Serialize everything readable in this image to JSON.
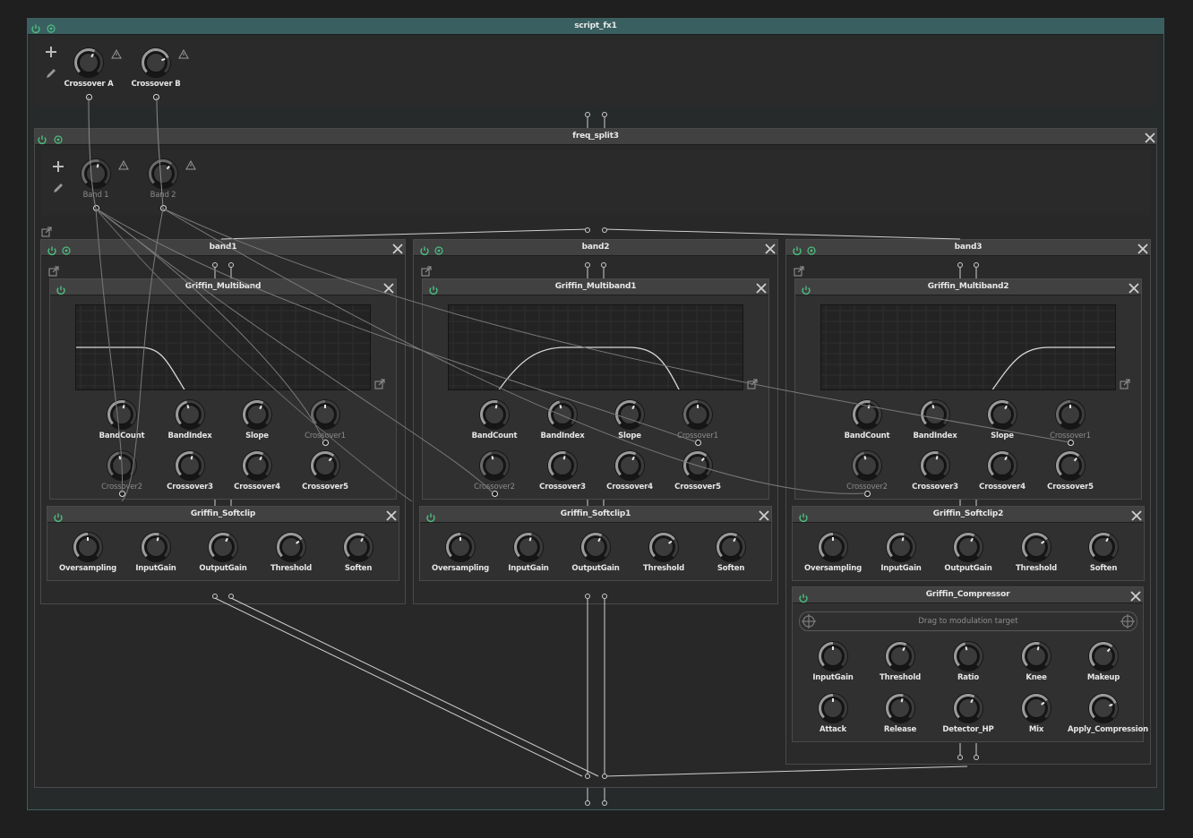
{
  "colors": {
    "accent": "#4cbf80",
    "header_bg": "#414141",
    "panel_bg": "#2b2b2b",
    "root_header": "#3a5f60"
  },
  "script_fx1": {
    "title": "script_fx1",
    "macros": [
      {
        "label": "Crossover A",
        "value": 0.6
      },
      {
        "label": "Crossover B",
        "value": 0.75
      }
    ]
  },
  "freq_split3": {
    "title": "freq_split3",
    "macros": [
      {
        "label": "Band 1",
        "value": 0.55
      },
      {
        "label": "Band 2",
        "value": 0.65
      }
    ]
  },
  "bands": [
    {
      "title": "band1",
      "mb_title": "Griffin_Multiband",
      "sc_title": "Griffin_Softclip",
      "curve": "lowpass"
    },
    {
      "title": "band2",
      "mb_title": "Griffin_Multiband1",
      "sc_title": "Griffin_Softclip1",
      "curve": "bandpass"
    },
    {
      "title": "band3",
      "mb_title": "Griffin_Multiband2",
      "sc_title": "Griffin_Softclip2",
      "curve": "highpass"
    }
  ],
  "multiband_knobs": [
    "BandCount",
    "BandIndex",
    "Slope",
    "Crossover1",
    "Crossover2",
    "Crossover3",
    "Crossover4",
    "Crossover5"
  ],
  "softclip_knobs": [
    "Oversampling",
    "InputGain",
    "OutputGain",
    "Threshold",
    "Soften"
  ],
  "compressor": {
    "title": "Griffin_Compressor",
    "drop_text": "Drag to modulation target",
    "knobs": [
      "InputGain",
      "Threshold",
      "Ratio",
      "Knee",
      "Makeup",
      "Attack",
      "Release",
      "Detector_HP",
      "Mix",
      "Apply_Compression"
    ]
  },
  "icons": [
    "power-icon",
    "reload-icon",
    "close-icon",
    "plus-icon",
    "pencil-icon",
    "warning-icon",
    "popout-icon",
    "crosshair-icon"
  ]
}
